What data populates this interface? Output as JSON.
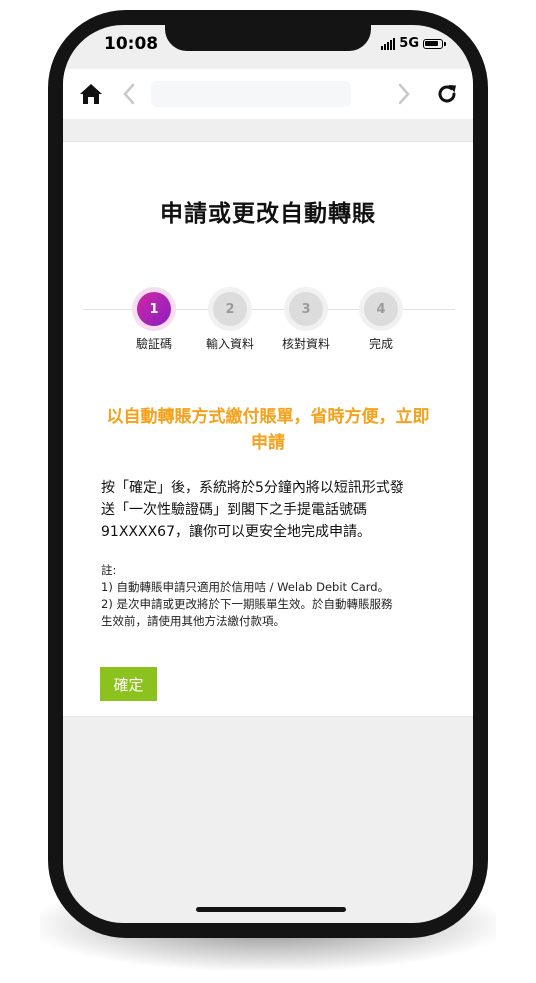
{
  "status_bar": {
    "time": "10:08",
    "network": "5G"
  },
  "browser_nav": {
    "icons": [
      "home-icon",
      "back-icon",
      "forward-icon",
      "refresh-icon"
    ]
  },
  "page": {
    "title": "申請或更改自動轉賬",
    "steps": [
      {
        "number": "1",
        "label": "驗証碼",
        "active": true
      },
      {
        "number": "2",
        "label": "輸入資料",
        "active": false
      },
      {
        "number": "3",
        "label": "核對資料",
        "active": false
      },
      {
        "number": "4",
        "label": "完成",
        "active": false
      }
    ],
    "promo_line1": "以自動轉賬方式繳付賬單，省時方便，立即",
    "promo_line2": "申請",
    "body_line1": "按「確定」後，系統將於5分鐘內將以短訊形式發",
    "body_line2": "送「一次性驗證碼」到閣下之手提電話號碼",
    "body_line3": "91XXXX67，讓你可以更安全地完成申請。",
    "notes_heading": "註:",
    "note_1": "1) 自動轉賬申請只適用於信用咭 / Welab Debit Card。",
    "note_2a": "2) 是次申請或更改將於下一期賬單生效。於自動轉賬服務",
    "note_2b": "生效前，請使用其他方法繳付款項。",
    "confirm_label": "確定"
  },
  "colors": {
    "accent_orange": "#f5a11c",
    "button_green": "#8cc21e",
    "active_step": "#c026a8"
  }
}
